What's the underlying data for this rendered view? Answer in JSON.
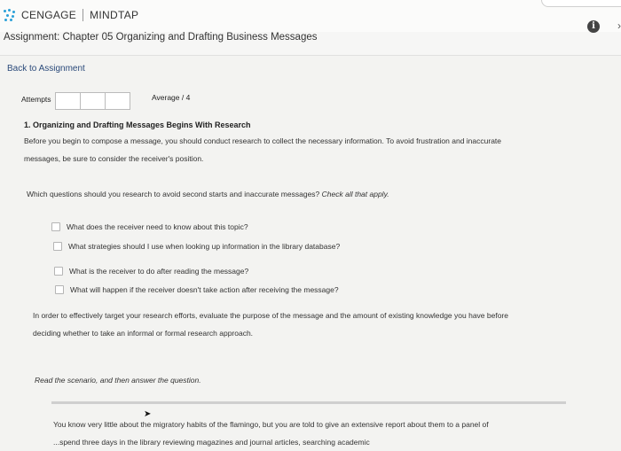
{
  "brand": {
    "name": "CENGAGE",
    "product": "MINDTAP"
  },
  "assignment": {
    "title": "Assignment: Chapter 05 Organizing and Drafting Business Messages"
  },
  "nav": {
    "back_label": "Back to Assignment"
  },
  "header": {
    "info_label": "i",
    "chevron_label": "›"
  },
  "scores": {
    "attempts_label": "Attempts",
    "average_label": "Average / 4"
  },
  "question": {
    "title": "1. Organizing and Drafting Messages Begins With Research",
    "intro_line1": "Before you begin to compose a message, you should conduct research to collect the necessary information. To avoid frustration and inaccurate",
    "intro_line2": "messages, be sure to consider the receiver's position.",
    "prompt_main": "Which questions should you research to avoid second starts and inaccurate messages? ",
    "prompt_italic": "Check all that apply.",
    "options": [
      "What does the receiver need to know about this topic?",
      "What strategies should I use when looking up information in the library database?",
      "What is the receiver to do after reading the message?",
      "What will happen if the receiver doesn't take action after receiving the message?"
    ],
    "research_line1": "In order to effectively target your research efforts, evaluate the purpose of the message and the amount of existing knowledge you have before",
    "research_line2": "deciding whether to take an informal or formal research approach.",
    "scenario_instruction": "Read the scenario, and then answer the question.",
    "scenario_line1": "You know very little about the migratory habits of the flamingo, but you are told to give an extensive report about them to a panel of",
    "scenario_line2": "...spend three days in the library reviewing magazines and journal articles, searching academic"
  }
}
